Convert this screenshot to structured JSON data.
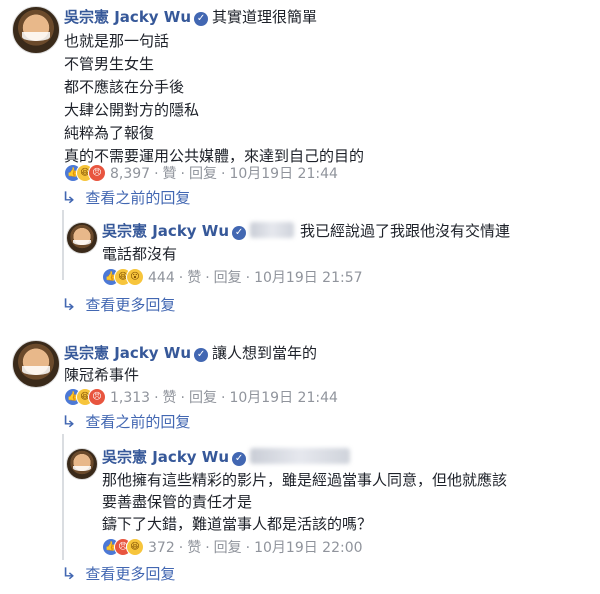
{
  "comments": [
    {
      "author": "吳宗憲 Jacky Wu",
      "verified_glyph": "✓",
      "lines": [
        "其實道理很簡單",
        "也就是那一句話",
        "不管男生女生",
        "都不應該在分手後",
        "大肆公開對方的隱私",
        "純粹為了報復",
        "真的不需要運用公共媒體，來達到自己的目的"
      ],
      "reaction_count": "8,397",
      "like": "贊",
      "reply": "回复",
      "time": "10月19日 21:44",
      "view_prev": "查看之前的回复",
      "reply_item": {
        "author": "吳宗憲 Jacky Wu",
        "lines": [
          "我已經說過了我跟他沒有交情連",
          "電話都沒有"
        ],
        "reaction_count": "444",
        "like": "赞",
        "reply": "回复",
        "time": "10月19日 21:57"
      },
      "view_more": "查看更多回复"
    },
    {
      "author": "吳宗憲 Jacky Wu",
      "verified_glyph": "✓",
      "lines": [
        "讓人想到當年的",
        "陳冠希事件"
      ],
      "reaction_count": "1,313",
      "like": "赞",
      "reply": "回复",
      "time": "10月19日 21:44",
      "view_prev": "查看之前的回复",
      "reply_item": {
        "author": "吳宗憲 Jacky Wu",
        "lines": [
          "那他擁有這些精彩的影片，雖是經過當事人同意，但他就應該",
          "要善盡保管的責任才是",
          "鑄下了大錯，難道當事人都是活該的嗎？"
        ],
        "reaction_count": "372",
        "like": "赞",
        "reply": "回复",
        "time": "10月19日 22:00"
      },
      "view_more": "查看更多回复"
    }
  ],
  "icons": {
    "like": "👍",
    "haha": "😆",
    "angry": "😠",
    "reply_arrow": "↳"
  },
  "colors": {
    "link": "#4267b2",
    "name": "#365899",
    "meta": "#90949c"
  }
}
